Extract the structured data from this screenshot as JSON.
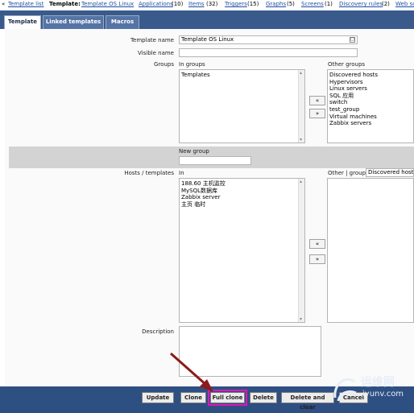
{
  "breadcrumb": {
    "back": "«",
    "template_list": "Template list",
    "template_label": "Template:",
    "template_name": "Template OS Linux",
    "applications": "Applications",
    "applications_count": "(10)",
    "items": "Items",
    "items_count": "(32)",
    "triggers": "Triggers",
    "triggers_count": "(15)",
    "graphs": "Graphs",
    "graphs_count": "(5)",
    "screens": "Screens",
    "screens_count": "(1)",
    "discovery": "Discovery rules",
    "discovery_count": "(2)",
    "web": "Web sc"
  },
  "tabs": [
    {
      "label": "Template",
      "active": true
    },
    {
      "label": "Linked templates",
      "active": false
    },
    {
      "label": "Macros",
      "active": false
    }
  ],
  "form": {
    "template_name_label": "Template name",
    "template_name_value": "Template OS Linux",
    "visible_name_label": "Visible name",
    "visible_name_value": "",
    "groups_label": "Groups",
    "in_groups_label": "In groups",
    "in_groups": [
      "Templates"
    ],
    "other_groups_label": "Other groups",
    "other_groups": [
      "Discovered hosts",
      "Hypervisors",
      "Linux servers",
      "SQL 应用",
      "switch",
      "test_group",
      "Virtual machines",
      "Zabbix servers"
    ],
    "move_left": "«",
    "move_right": "»",
    "new_group_label": "New group",
    "new_group_value": "",
    "hosts_label": "Hosts / templates",
    "in_label": "In",
    "hosts_in": [
      "188.60 主机监控",
      "MySQL数据库",
      "Zabbix server",
      "主页 临时"
    ],
    "other_group_label": "Other | group",
    "other_group_select": "Discovered hosts",
    "description_label": "Description",
    "description_value": ""
  },
  "footer": {
    "update": "Update",
    "clone": "Clone",
    "full_clone": "Full clone",
    "delete": "Delete",
    "delete_and_clear": "Delete and clear",
    "cancel": "Cancel"
  },
  "watermark": {
    "line1": "运维网",
    "line2": "iyunv.com"
  },
  "colors": {
    "header_bar": "#3a5a8c",
    "footer_bar": "#2e4f82",
    "highlight": "#e414b8",
    "arrow": "#8b1a1a"
  }
}
